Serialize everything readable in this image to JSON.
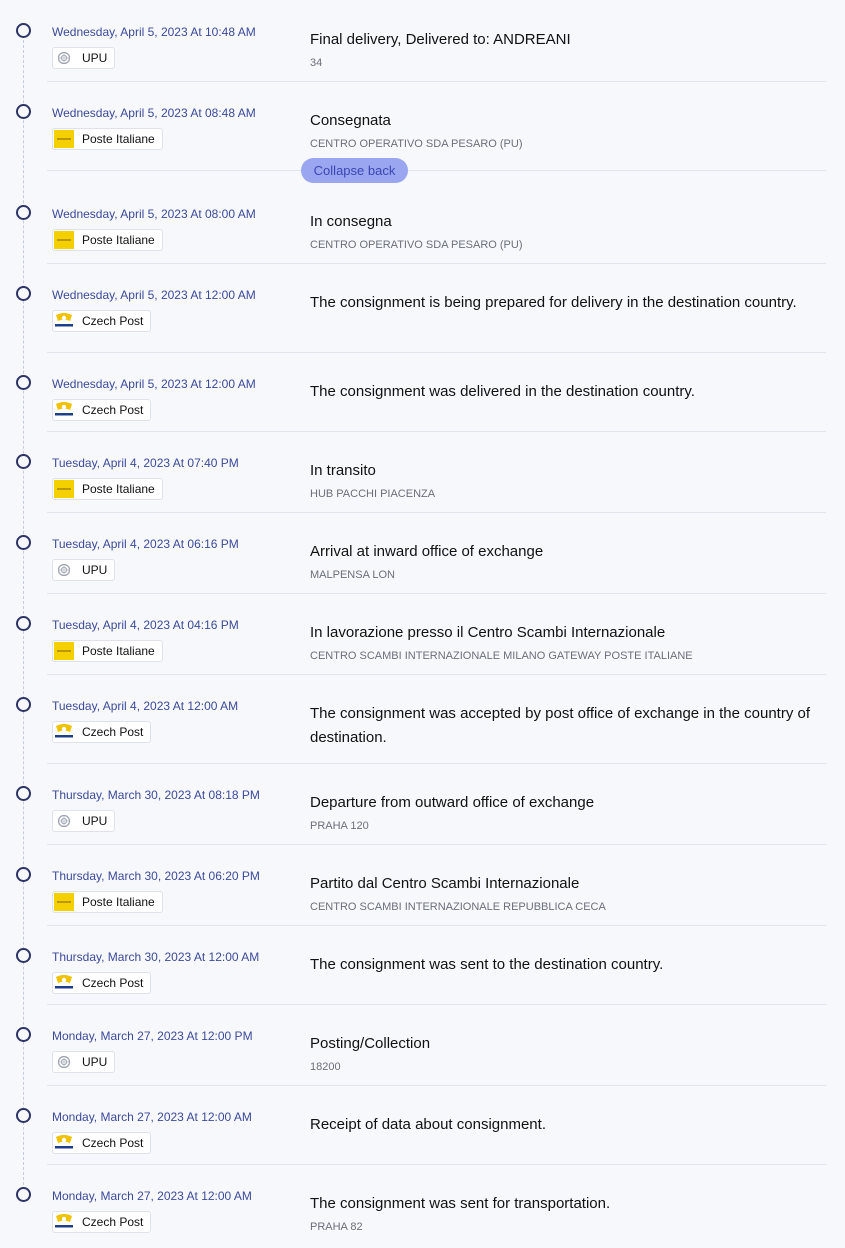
{
  "collapse_label": "Collapse back",
  "colors": {
    "date_text": "#3b4a9a",
    "dot_ring": "#2d3466",
    "collapse_bg": "#9aa6f0",
    "collapse_text": "#3a47b3",
    "poste_yellow": "#f5d000",
    "czech_yellow": "#f2c200",
    "czech_blue": "#1d3e8a"
  },
  "carriers": {
    "upu": {
      "name": "UPU",
      "icon": "upu-logo-icon"
    },
    "poste": {
      "name": "Poste Italiane",
      "icon": "poste-italiane-logo-icon"
    },
    "czech": {
      "name": "Czech Post",
      "icon": "czech-post-logo-icon"
    }
  },
  "events": [
    {
      "date": "Wednesday, April 5, 2023 At 10:48 AM",
      "carrier": "UPU",
      "title": "Final delivery, Delivered to: ANDREANI",
      "place": "34"
    },
    {
      "date": "Wednesday, April 5, 2023 At 08:48 AM",
      "carrier": "Poste Italiane",
      "title": "Consegnata",
      "place": "CENTRO OPERATIVO SDA PESARO (PU)"
    },
    {
      "date": "Wednesday, April 5, 2023 At 08:00 AM",
      "carrier": "Poste Italiane",
      "title": "In consegna",
      "place": "CENTRO OPERATIVO SDA PESARO (PU)"
    },
    {
      "date": "Wednesday, April 5, 2023 At 12:00 AM",
      "carrier": "Czech Post",
      "title": "The consignment is being prepared for delivery in the destination country.",
      "place": ""
    },
    {
      "date": "Wednesday, April 5, 2023 At 12:00 AM",
      "carrier": "Czech Post",
      "title": "The consignment was delivered in the destination country.",
      "place": ""
    },
    {
      "date": "Tuesday, April 4, 2023 At 07:40 PM",
      "carrier": "Poste Italiane",
      "title": "In transito",
      "place": "HUB PACCHI PIACENZA"
    },
    {
      "date": "Tuesday, April 4, 2023 At 06:16 PM",
      "carrier": "UPU",
      "title": "Arrival at inward office of exchange",
      "place": "MALPENSA LON"
    },
    {
      "date": "Tuesday, April 4, 2023 At 04:16 PM",
      "carrier": "Poste Italiane",
      "title": "In lavorazione presso il Centro Scambi Internazionale",
      "place": "CENTRO SCAMBI INTERNAZIONALE MILANO GATEWAY POSTE ITALIANE"
    },
    {
      "date": "Tuesday, April 4, 2023 At 12:00 AM",
      "carrier": "Czech Post",
      "title": "The consignment was accepted by post office of exchange in the country of destination.",
      "place": ""
    },
    {
      "date": "Thursday, March 30, 2023 At 08:18 PM",
      "carrier": "UPU",
      "title": "Departure from outward office of exchange",
      "place": "PRAHA 120"
    },
    {
      "date": "Thursday, March 30, 2023 At 06:20 PM",
      "carrier": "Poste Italiane",
      "title": "Partito dal Centro Scambi Internazionale",
      "place": "CENTRO SCAMBI INTERNAZIONALE REPUBBLICA CECA"
    },
    {
      "date": "Thursday, March 30, 2023 At 12:00 AM",
      "carrier": "Czech Post",
      "title": "The consignment was sent to the destination country.",
      "place": ""
    },
    {
      "date": "Monday, March 27, 2023 At 12:00 PM",
      "carrier": "UPU",
      "title": "Posting/Collection",
      "place": "18200"
    },
    {
      "date": "Monday, March 27, 2023 At 12:00 AM",
      "carrier": "Czech Post",
      "title": "Receipt of data about consignment.",
      "place": ""
    },
    {
      "date": "Monday, March 27, 2023 At 12:00 AM",
      "carrier": "Czech Post",
      "title": "The consignment was sent for transportation.",
      "place": "PRAHA 82"
    }
  ]
}
